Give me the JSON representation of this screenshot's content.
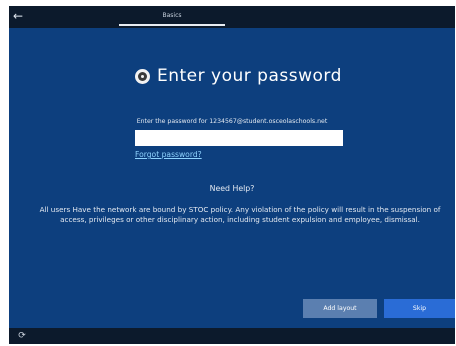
{
  "topbar": {
    "back_icon": "back-arrow-icon",
    "tab_label": "Basics"
  },
  "title": {
    "icon": "user-shield-icon",
    "text": "Enter your password"
  },
  "prompt": {
    "text": "Enter the password for 1234567@student.osceolaschools.net"
  },
  "password_field": {
    "value": "",
    "placeholder": ""
  },
  "links": {
    "forgot_password": "Forgot password?"
  },
  "help": {
    "need_help": "Need Help?",
    "policy_text": "All users Have the network are bound by STOC policy. Any violation of the policy will result in the suspension of access, privileges or other disciplinary action, including student expulsion and employee, dismissal."
  },
  "buttons": {
    "add_layout": "Add layout",
    "skip": "Skip"
  },
  "bottombar": {
    "reload_icon": "reload-icon"
  },
  "colors": {
    "background": "#0d3f7e",
    "bars": "#0c1a2c",
    "link": "#8fd3ff",
    "secondary_button": "#5b7fb0",
    "primary_button": "#2a6cd6"
  }
}
